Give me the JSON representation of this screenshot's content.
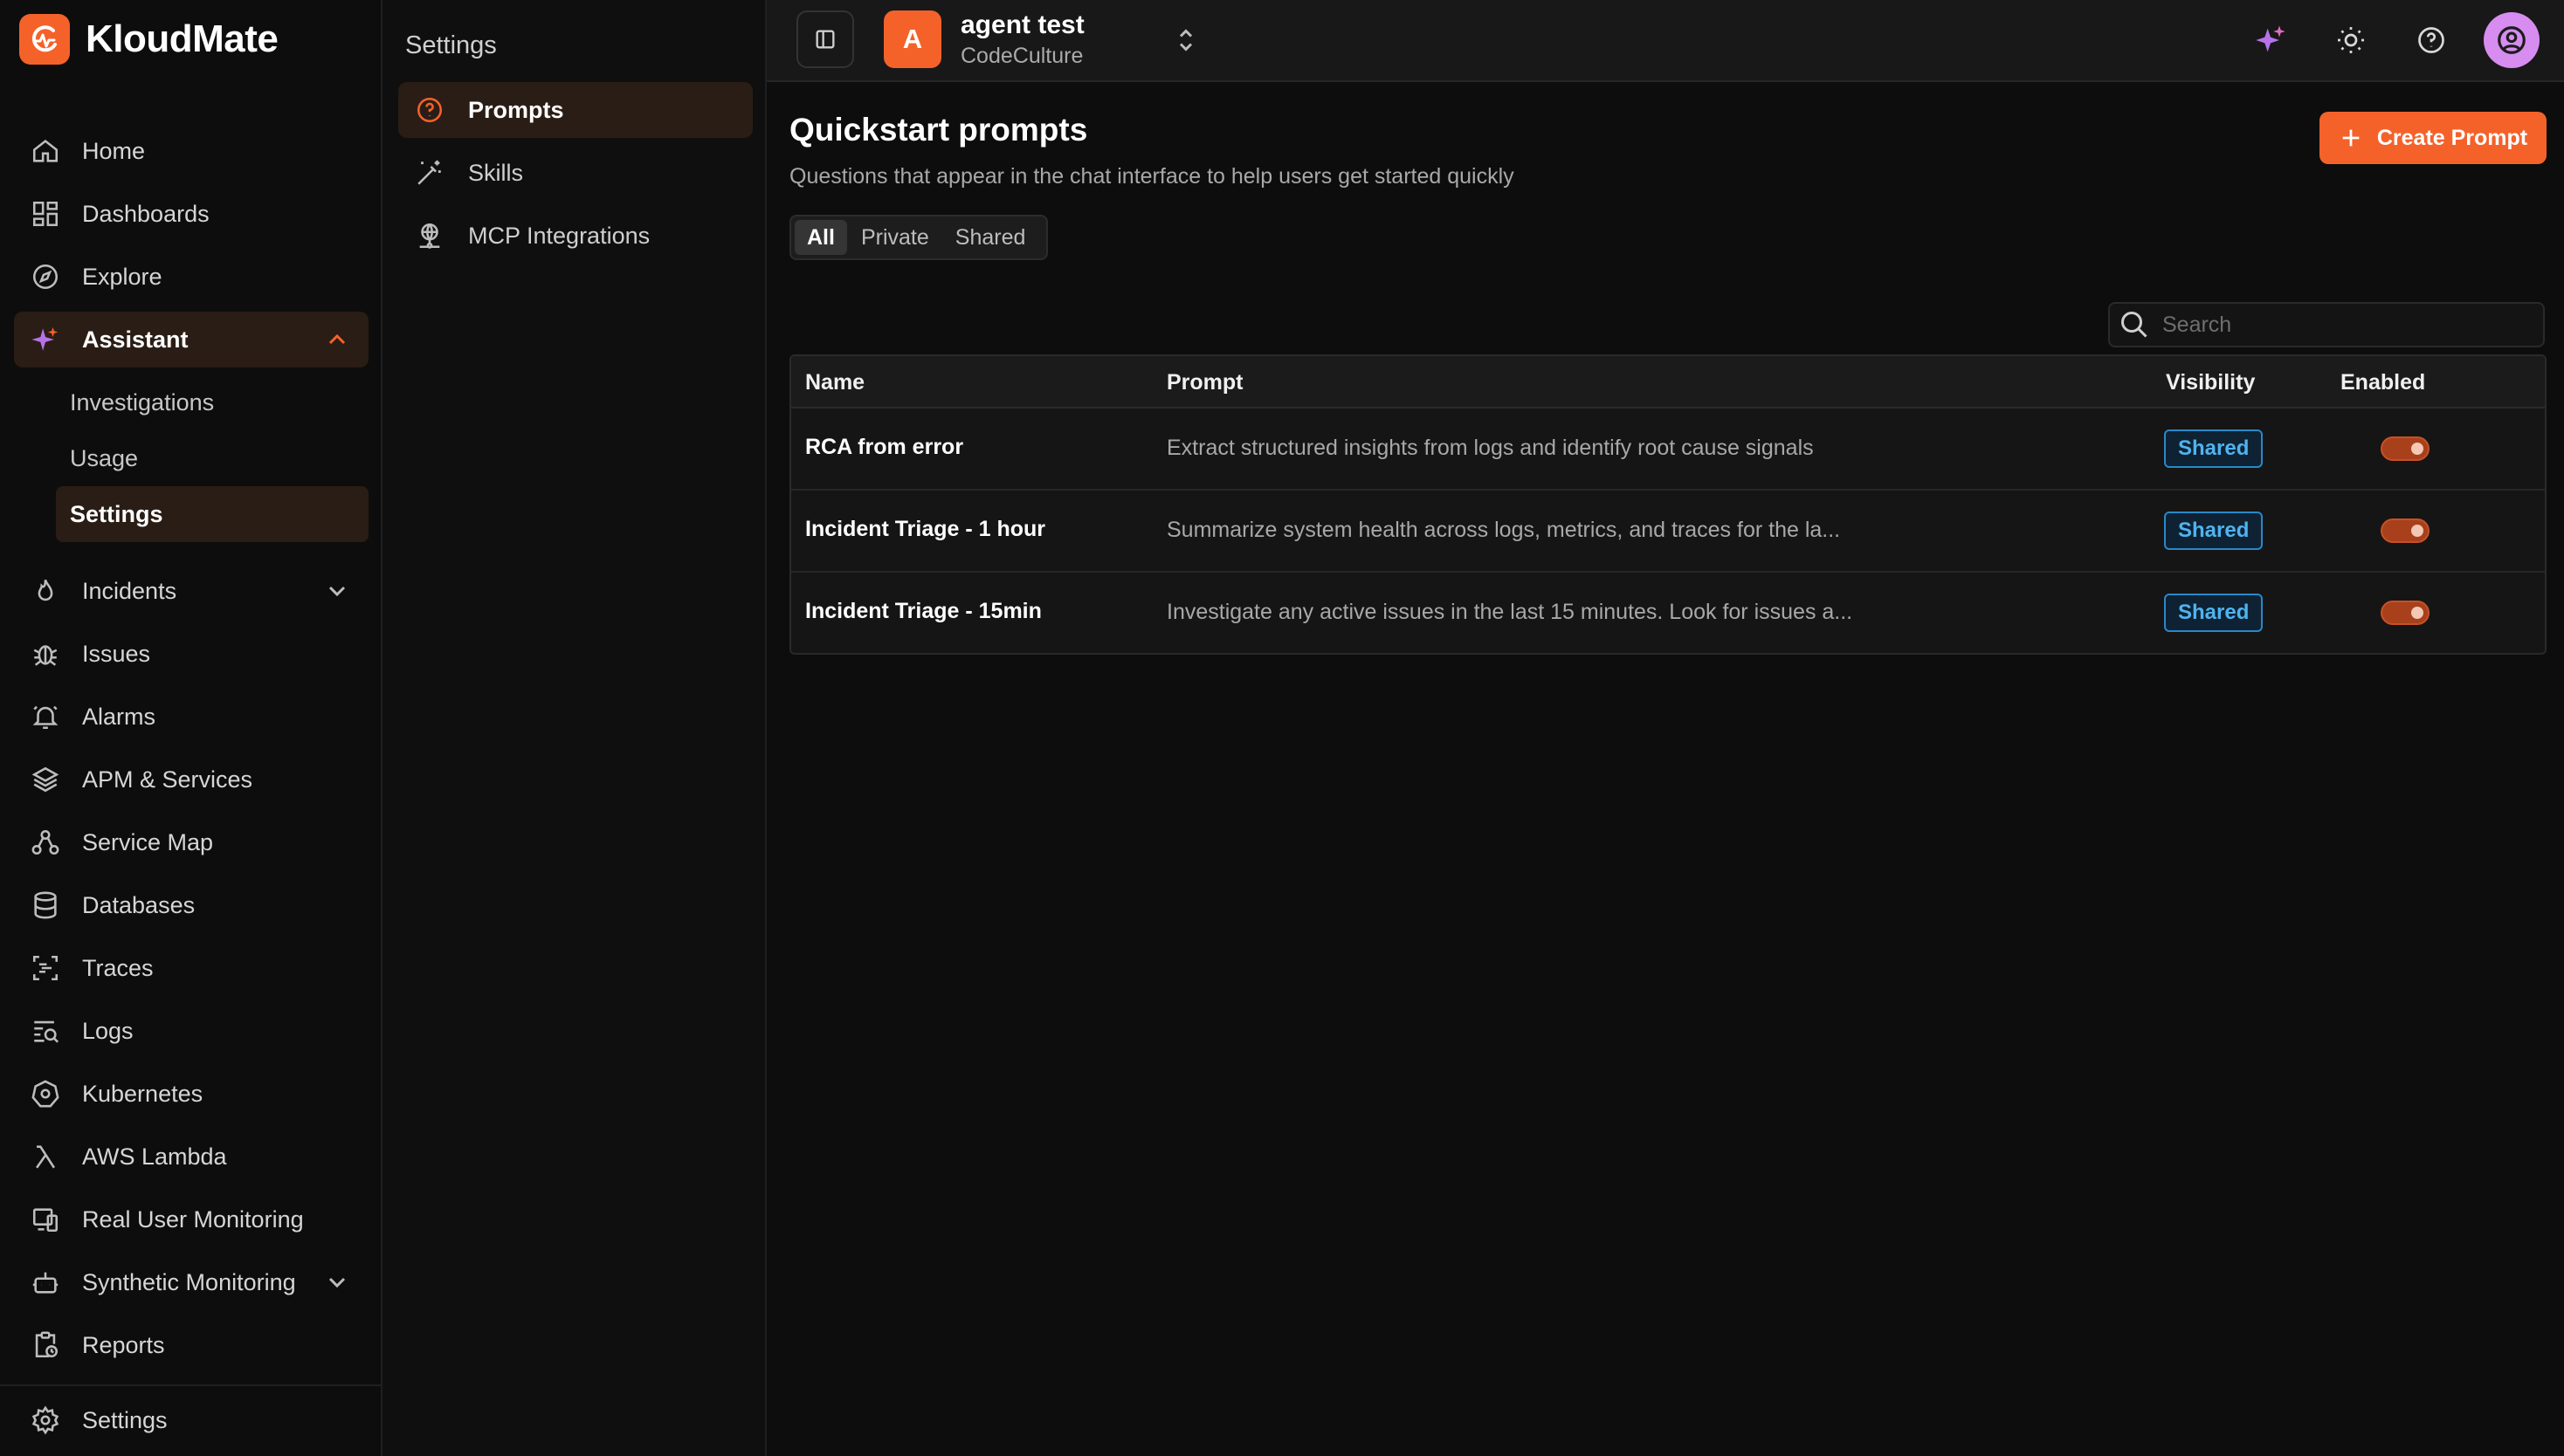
{
  "brand": {
    "name": "KloudMate"
  },
  "sidebar": {
    "items": [
      {
        "label": "Home"
      },
      {
        "label": "Dashboards"
      },
      {
        "label": "Explore"
      },
      {
        "label": "Assistant"
      },
      {
        "label": "Incidents"
      },
      {
        "label": "Issues"
      },
      {
        "label": "Alarms"
      },
      {
        "label": "APM & Services"
      },
      {
        "label": "Service Map"
      },
      {
        "label": "Databases"
      },
      {
        "label": "Traces"
      },
      {
        "label": "Logs"
      },
      {
        "label": "Kubernetes"
      },
      {
        "label": "AWS Lambda"
      },
      {
        "label": "Real User Monitoring"
      },
      {
        "label": "Synthetic Monitoring"
      },
      {
        "label": "Reports"
      },
      {
        "label": "Settings"
      }
    ],
    "assistant_sub": [
      {
        "label": "Investigations"
      },
      {
        "label": "Usage"
      },
      {
        "label": "Settings"
      }
    ]
  },
  "settings_panel": {
    "title": "Settings",
    "items": [
      {
        "label": "Prompts"
      },
      {
        "label": "Skills"
      },
      {
        "label": "MCP Integrations"
      }
    ]
  },
  "topbar": {
    "workspace_initial": "A",
    "workspace_name": "agent test",
    "workspace_org": "CodeCulture"
  },
  "main": {
    "title": "Quickstart prompts",
    "subtitle": "Questions that appear in the chat interface to help users get started quickly",
    "create_button": "Create Prompt",
    "filters": [
      "All",
      "Private",
      "Shared"
    ],
    "active_filter": "All",
    "search_placeholder": "Search",
    "columns": {
      "name": "Name",
      "prompt": "Prompt",
      "visibility": "Visibility",
      "enabled": "Enabled"
    },
    "rows": [
      {
        "name": "RCA from error",
        "prompt": "Extract structured insights from logs and identify root cause signals",
        "visibility": "Shared",
        "enabled": true
      },
      {
        "name": "Incident Triage - 1 hour",
        "prompt": "Summarize system health across logs, metrics, and traces for the la...",
        "visibility": "Shared",
        "enabled": true
      },
      {
        "name": "Incident Triage - 15min",
        "prompt": "Investigate any active issues in the last 15 minutes. Look for issues a...",
        "visibility": "Shared",
        "enabled": true
      }
    ]
  },
  "colors": {
    "accent": "#f4622a",
    "background": "#0d0d0d",
    "badge_blue": "#4fb3f0",
    "user_avatar": "#d78cf0"
  },
  "icons": [
    "home-icon",
    "dashboards-icon",
    "explore-icon",
    "assistant-sparkle-icon",
    "incidents-flame-icon",
    "issues-bug-icon",
    "alarms-bell-icon",
    "apm-layers-icon",
    "service-map-icon",
    "databases-icon",
    "traces-icon",
    "logs-icon",
    "kubernetes-icon",
    "lambda-icon",
    "rum-icon",
    "synthetic-robot-icon",
    "reports-icon",
    "settings-gear-icon"
  ]
}
